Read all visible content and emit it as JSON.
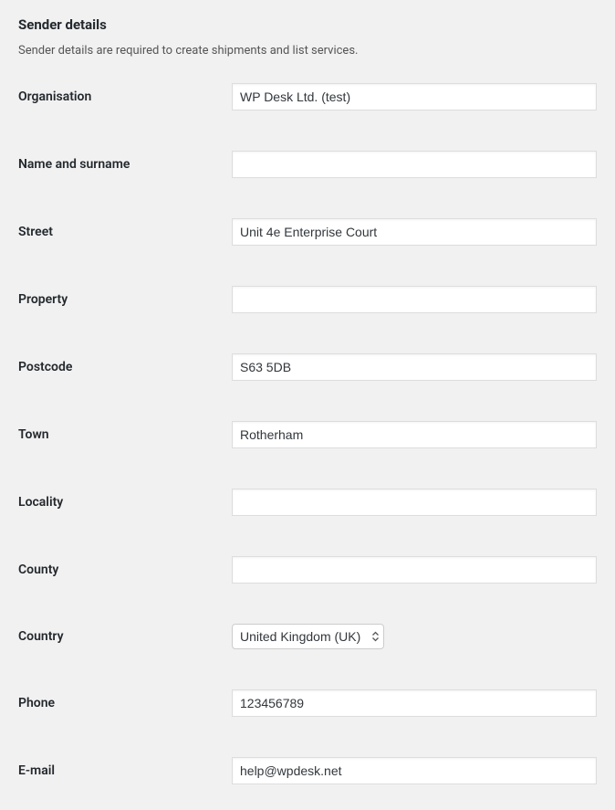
{
  "section": {
    "title": "Sender details",
    "description": "Sender details are required to create shipments and list services."
  },
  "fields": {
    "organisation": {
      "label": "Organisation",
      "value": "WP Desk Ltd. (test)"
    },
    "name_surname": {
      "label": "Name and surname",
      "value": ""
    },
    "street": {
      "label": "Street",
      "value": "Unit 4e Enterprise Court"
    },
    "property": {
      "label": "Property",
      "value": ""
    },
    "postcode": {
      "label": "Postcode",
      "value": "S63 5DB"
    },
    "town": {
      "label": "Town",
      "value": "Rotherham"
    },
    "locality": {
      "label": "Locality",
      "value": ""
    },
    "county": {
      "label": "County",
      "value": ""
    },
    "country": {
      "label": "Country",
      "value": "United Kingdom (UK)"
    },
    "phone": {
      "label": "Phone",
      "value": "123456789"
    },
    "email": {
      "label": "E-mail",
      "value": "help@wpdesk.net"
    }
  }
}
